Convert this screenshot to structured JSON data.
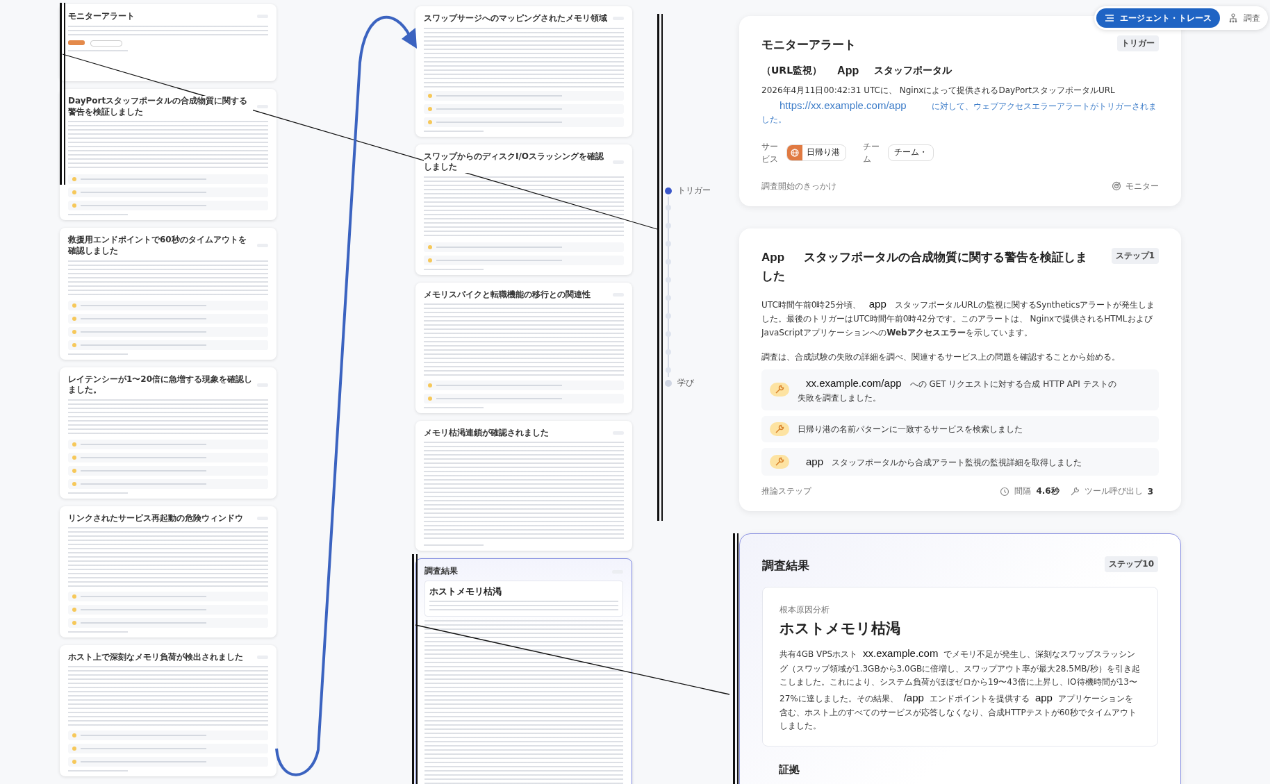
{
  "view_toggle": [
    {
      "label": "エージェント・トレース",
      "selected": true,
      "kind": "trace"
    },
    {
      "label": "調査",
      "selected": false,
      "kind": "tree"
    }
  ],
  "overview": {
    "columns": [
      {
        "cards": [
          {
            "title": "モニターアラート",
            "kind": "trigger",
            "selected": false
          },
          {
            "title": "DayPortスタッフポータルの合成物質に関する警告を検証しました",
            "kind": "step",
            "selected": false,
            "tools": [
              {
                "kind": "tool"
              },
              {
                "kind": "tool"
              },
              {
                "kind": "tool"
              }
            ]
          },
          {
            "title": "救援用エンドポイントで60秒のタイムアウトを確認しました",
            "kind": "step",
            "selected": false,
            "tools": [
              {
                "kind": "tool"
              },
              {
                "kind": "tool"
              },
              {
                "kind": "tool"
              },
              {
                "kind": "tool"
              }
            ]
          },
          {
            "title": "レイテンシーが1〜20倍に急増する現象を確認しました。",
            "kind": "step",
            "selected": false,
            "tools": [
              {
                "kind": "tool"
              },
              {
                "kind": "tool"
              },
              {
                "kind": "tool"
              },
              {
                "kind": "tool"
              }
            ]
          },
          {
            "title": "リンクされたサービス再起動の危険ウィンドウ",
            "kind": "step",
            "selected": false,
            "tools": [
              {
                "kind": "tool"
              },
              {
                "kind": "tool"
              },
              {
                "kind": "tool"
              }
            ]
          },
          {
            "title": "ホスト上で深刻なメモリ負荷が検出されました",
            "kind": "step",
            "selected": false,
            "tools": [
              {
                "kind": "tool"
              },
              {
                "kind": "tool"
              },
              {
                "kind": "tool"
              }
            ]
          }
        ]
      },
      {
        "cards": [
          {
            "title": "スワップサージへのマッピングされたメモリ領域",
            "kind": "step",
            "selected": false,
            "tools": [
              {
                "kind": "tool"
              },
              {
                "kind": "tool"
              },
              {
                "kind": "tool"
              }
            ]
          },
          {
            "title": "スワップからのディスクI/Oスラッシングを確認しました",
            "kind": "step",
            "selected": false,
            "tools": [
              {
                "kind": "tool"
              },
              {
                "kind": "tool"
              }
            ]
          },
          {
            "title": "メモリスパイクと転職機能の移行との関連性",
            "kind": "step",
            "selected": false,
            "tools": [
              {
                "kind": "tool"
              },
              {
                "kind": "tool"
              }
            ]
          },
          {
            "title": "メモリ枯渇連鎖が確認されました",
            "kind": "step",
            "selected": false
          },
          {
            "title": "調査結果",
            "subtitle": "ホストメモリ枯渇",
            "kind": "result",
            "selected": true
          }
        ]
      }
    ]
  },
  "timeline": {
    "start": {
      "label": "トリガー",
      "selected": true
    },
    "end": {
      "label": "学び",
      "selected": false
    }
  },
  "trigger_card": {
    "title": "モニターアラート",
    "badge": "トリガー",
    "subtitle": [
      "（URL監視）",
      "App",
      "スタッフポータル"
    ],
    "description": {
      "before": "2026年4月11日00:42:31 UTCに、 Nginxによって提供されるDayPortスタッフポータルURL",
      "link": "https://xx.example.com/app",
      "after": "に対して、ウェブアクセスエラーアラートがトリガーされました。"
    },
    "fields": [
      {
        "label": "サービス",
        "value": "日帰り港",
        "kind": "service"
      },
      {
        "label": "チーム",
        "value": "チーム・",
        "kind": "team"
      }
    ],
    "footer": "調査開始のきっかけ",
    "source": "モニター"
  },
  "step_card": {
    "title_prefix": "App",
    "title": "スタッフポータルの合成物質に関する警告を検証しました",
    "badge": "ステップ1",
    "paragraphs": [
      {
        "prefix": "UTC時間午前0時25分頃、",
        "code": "app",
        "text": "スタッフポータルURLの監視に関するSyntheticsアラートが発生しました。最後のトリガーはUTC時間午前0時42分です。このアラートは、 Nginxで提供されるHTMLおよびJavaScriptアプリケーションへの**Webアクセスエラー**を示しています。"
      },
      {
        "text": "調査は、合成試験の失敗の詳細を調べ、関連するサービス上の問題を確認することから始める。"
      }
    ],
    "tools": [
      {
        "code": "xx.example.com/app",
        "text": "への GET リクエストに対する合成 HTTP API テストの失敗を調査しました。"
      },
      {
        "text": "日帰り港の名前パターンに一致するサービスを検索しました"
      },
      {
        "code": "app",
        "text": "スタッフポータルから合成アラート監視の監視詳細を取得しました"
      }
    ],
    "footer": "推論ステップ",
    "duration_label": "間隔",
    "duration": "4.6秒",
    "calls_label": "ツール呼び出し",
    "calls": "3"
  },
  "result_card": {
    "title": "調査結果",
    "badge": "ステップ10",
    "kicker": "根本原因分析",
    "headline": "ホストメモリ枯渇",
    "body": [
      {
        "text": "共有4GB VPSホスト"
      },
      {
        "code": "xx.example.com"
      },
      {
        "text": "でメモリ不足が発生し、深刻なスワップスラッシング（スワップ領域が1.3GBから3.0GBに倍増し、スワップアウト率が最大28.5MB/秒）を引き起こしました。これにより、システム負荷がほぼゼロから19〜43倍に上昇し、IO待機時間が13〜27%に達しました。その結果、"
      },
      {
        "code": "/app"
      },
      {
        "text": "エンドポイントを提供する"
      },
      {
        "code": "app"
      },
      {
        "text": "アプリケーションを含む、ホスト上のすべてのサービスが応答しなくなり、合成HTTPテストが60秒でタイムアウトしました。"
      }
    ],
    "section": "証拠"
  }
}
